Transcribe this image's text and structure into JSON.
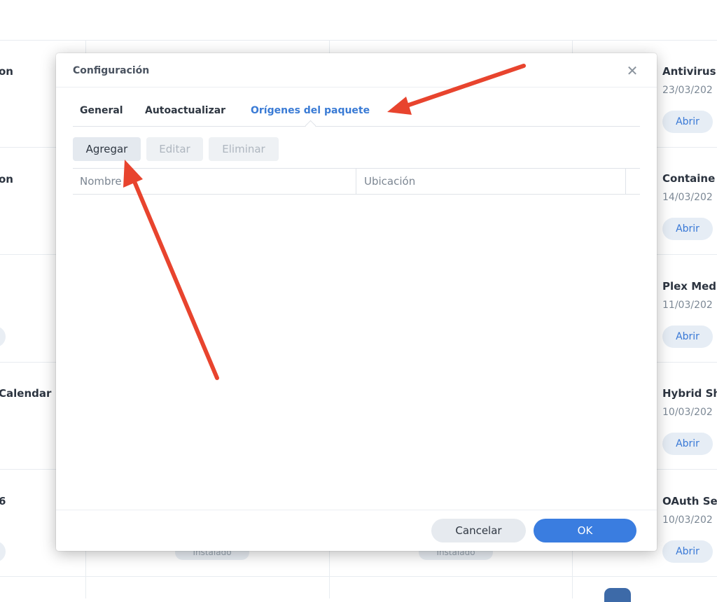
{
  "background": {
    "left_column_titles": [
      "on",
      "on",
      "Calendar",
      "6"
    ],
    "installed_label": "Instalado",
    "cards": [
      {
        "title": "Antivirus",
        "date": "23/03/202",
        "open_label": "Abrir"
      },
      {
        "title": "Containe",
        "date": "14/03/202",
        "open_label": "Abrir"
      },
      {
        "title": "Plex Med",
        "date": "11/03/202",
        "open_label": "Abrir"
      },
      {
        "title": "Hybrid Sh",
        "date": "10/03/202",
        "open_label": "Abrir"
      },
      {
        "title": "OAuth Se",
        "date": "10/03/202",
        "open_label": "Abrir"
      }
    ]
  },
  "dialog": {
    "title": "Configuración",
    "close_icon": "close-icon",
    "tabs": [
      {
        "label": "General",
        "active": false
      },
      {
        "label": "Autoactualizar",
        "active": false
      },
      {
        "label": "Orígenes del paquete",
        "active": true
      }
    ],
    "toolbar": {
      "add_label": "Agregar",
      "edit_label": "Editar",
      "delete_label": "Eliminar"
    },
    "table": {
      "columns": [
        "Nombre",
        "Ubicación"
      ],
      "rows": []
    },
    "footer": {
      "cancel_label": "Cancelar",
      "ok_label": "OK"
    }
  },
  "colors": {
    "accent": "#3a7bd5",
    "ok_button": "#3a7de0",
    "annotation_arrow": "#e8442e"
  }
}
